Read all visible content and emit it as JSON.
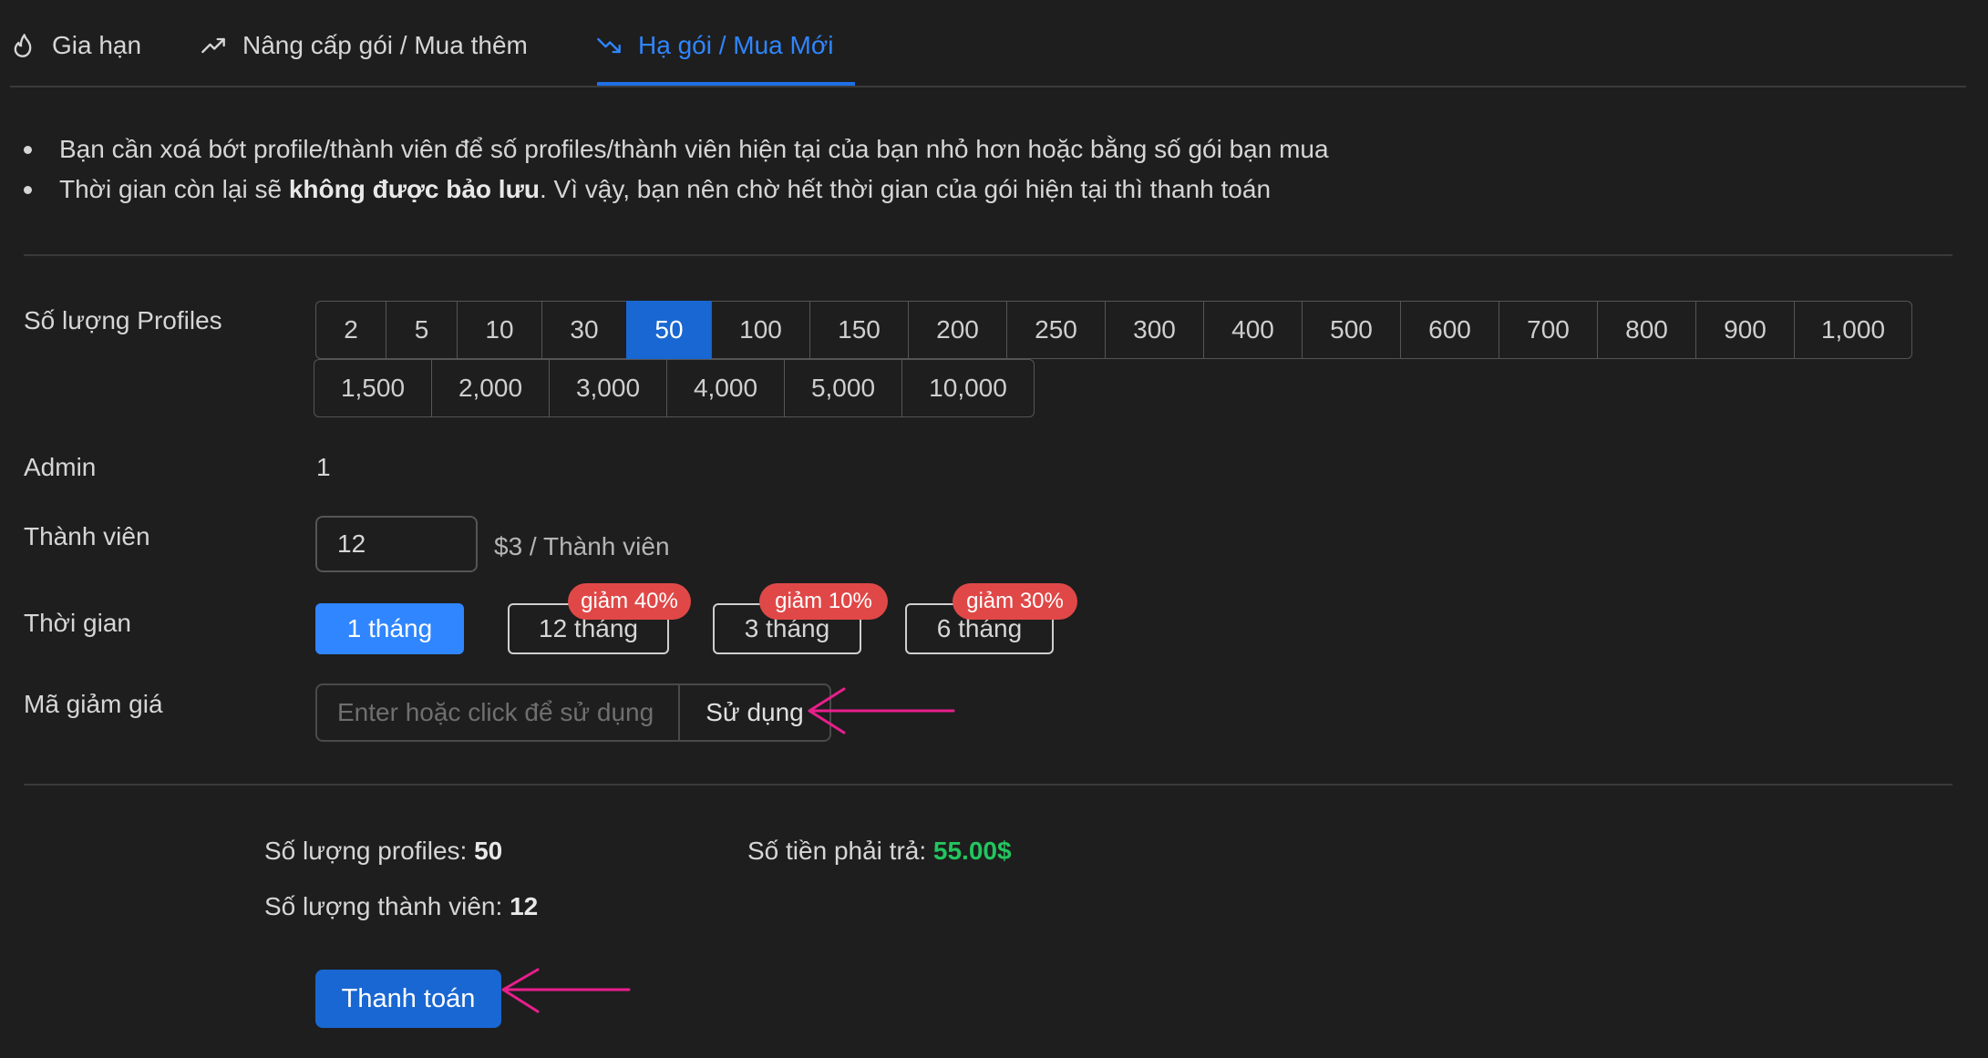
{
  "tabs": [
    {
      "label": "Gia hạn",
      "icon": "flame-icon"
    },
    {
      "label": "Nâng cấp gói / Mua thêm",
      "icon": "trending-up-icon"
    },
    {
      "label": "Hạ gói / Mua Mới",
      "icon": "trending-down-icon",
      "active": true
    }
  ],
  "notes": {
    "note1": "Bạn cần xoá bớt profile/thành viên để số profiles/thành viên hiện tại của bạn nhỏ hơn hoặc bằng số gói bạn mua",
    "note2_before": "Thời gian còn lại sẽ ",
    "note2_bold": "không được bảo lưu",
    "note2_after": ". Vì vậy, bạn nên chờ hết thời gian của gói hiện tại thì thanh toán"
  },
  "profiles": {
    "label": "Số lượng Profiles",
    "row1": [
      "2",
      "5",
      "10",
      "30",
      "50",
      "100",
      "150",
      "200",
      "250",
      "300",
      "400",
      "500",
      "600",
      "700",
      "800",
      "900",
      "1,000"
    ],
    "row2": [
      "1,500",
      "2,000",
      "3,000",
      "4,000",
      "5,000",
      "10,000"
    ],
    "selected": "50"
  },
  "admin": {
    "label": "Admin",
    "value": "1"
  },
  "members": {
    "label": "Thành viên",
    "value": "12",
    "price_note": "$3 / Thành viên"
  },
  "duration": {
    "label": "Thời gian",
    "options": [
      {
        "label": "1 tháng",
        "selected": true
      },
      {
        "label": "12 tháng",
        "badge": "giảm 40%"
      },
      {
        "label": "3 tháng",
        "badge": "giảm 10%"
      },
      {
        "label": "6 tháng",
        "badge": "giảm 30%"
      }
    ]
  },
  "coupon": {
    "label": "Mã giảm giá",
    "placeholder": "Enter hoặc click để sử dụng",
    "button": "Sử dụng"
  },
  "summary": {
    "profiles_label": "Số lượng profiles: ",
    "profiles_value": "50",
    "members_label": "Số lượng thành viên: ",
    "members_value": "12",
    "amount_label": "Số tiền phải trả: ",
    "amount_value": "55.00$"
  },
  "pay_button": "Thanh toán",
  "colors": {
    "accent": "#1967d2",
    "active_tab": "#2f86ff",
    "price": "#22c55e",
    "badge": "#e04848",
    "arrow": "#e91e8c"
  }
}
